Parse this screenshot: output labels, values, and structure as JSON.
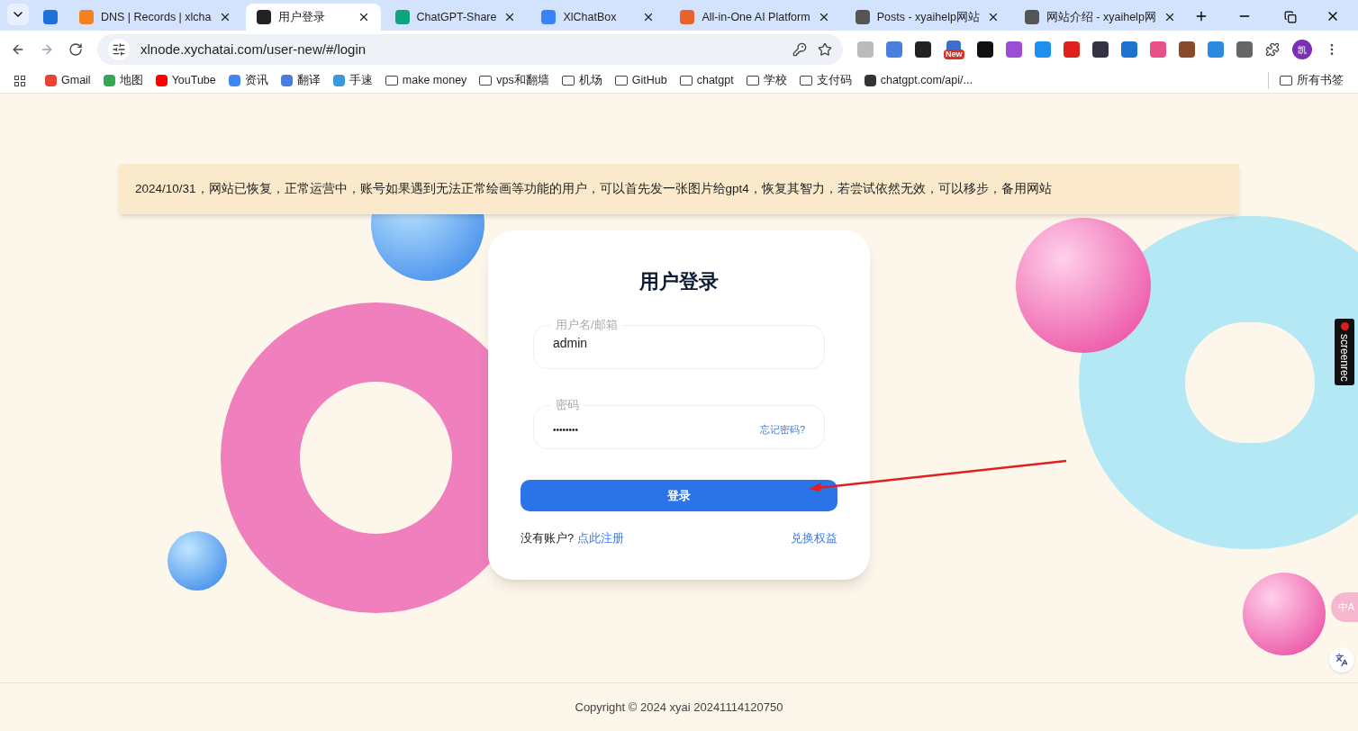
{
  "browser": {
    "tabs": [
      {
        "selected": false
      },
      {
        "title": "DNS | Records | xlcha",
        "selected": false
      },
      {
        "title": "用户登录",
        "selected": true
      },
      {
        "title": "ChatGPT-Share",
        "selected": false
      },
      {
        "title": "XlChatBox",
        "selected": false
      },
      {
        "title": "All-in-One AI Platform",
        "selected": false
      },
      {
        "title": "Posts - xyaihelp网站",
        "selected": false
      },
      {
        "title": "网站介绍 - xyaihelp网",
        "selected": false
      }
    ],
    "url": "xlnode.xychatai.com/user-new/#/login",
    "new_badge": "New",
    "profile": "凯",
    "bookmarks": [
      {
        "kind": "site",
        "label": "Gmail"
      },
      {
        "kind": "site",
        "label": "地图"
      },
      {
        "kind": "site",
        "label": "YouTube"
      },
      {
        "kind": "site",
        "label": "资讯"
      },
      {
        "kind": "site",
        "label": "翻译"
      },
      {
        "kind": "site",
        "label": "手速"
      },
      {
        "kind": "folder",
        "label": "make money"
      },
      {
        "kind": "folder",
        "label": "vps和翻墙"
      },
      {
        "kind": "folder",
        "label": "机场"
      },
      {
        "kind": "folder",
        "label": "GitHub"
      },
      {
        "kind": "folder",
        "label": "chatgpt"
      },
      {
        "kind": "folder",
        "label": "学校"
      },
      {
        "kind": "folder",
        "label": "支付码"
      },
      {
        "kind": "site",
        "label": "chatgpt.com/api/..."
      }
    ],
    "all_bookmarks": "所有书签"
  },
  "notice": "2024/10/31，网站已恢复，正常运营中，账号如果遇到无法正常绘画等功能的用户，可以首先发一张图片给gpt4，恢复其智力，若尝试依然无效，可以移步，备用网站",
  "login": {
    "title": "用户登录",
    "username": {
      "label": "用户名/邮箱",
      "value": "admin"
    },
    "password": {
      "label": "密码",
      "value": "••••••••",
      "forgot": "忘记密码?"
    },
    "submit": "登录",
    "no_account": "没有账户?",
    "register": "点此注册",
    "redeem": "兑换权益"
  },
  "recorder_badge": "screenrec",
  "translate_badge": "中A",
  "footer": "Copyright © 2024 xyai 20241114120750"
}
